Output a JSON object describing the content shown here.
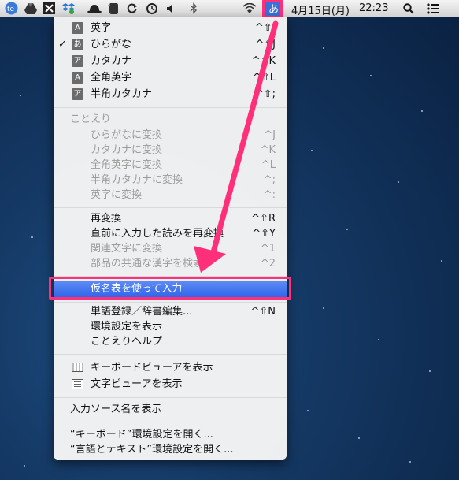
{
  "menubar": {
    "icons": [
      "te-icon",
      "drive-icon",
      "x-icon",
      "dropbox-icon",
      "hat-icon",
      "evernote-icon",
      "sync-icon",
      "time-machine-icon",
      "volume-icon",
      "bluetooth-icon",
      "wifi-icon"
    ],
    "ime_label": "あ",
    "date": "4月15日(月)",
    "time": "22:23"
  },
  "menu": {
    "modes": [
      {
        "glyph": "A",
        "label": "英字",
        "shortcut": "^⇧;"
      },
      {
        "glyph": "あ",
        "label": "ひらがな",
        "shortcut": "^⇧J",
        "checked": true
      },
      {
        "glyph": "ア",
        "label": "カタカナ",
        "shortcut": "^⇧K"
      },
      {
        "glyph": "A",
        "label": "全角英字",
        "shortcut": "^⇧L"
      },
      {
        "glyph": "ア",
        "label": "半角カタカナ",
        "shortcut": "^⇧;"
      }
    ],
    "kotoeri_header": "ことえり",
    "convert": [
      {
        "label": "ひらがなに変換",
        "shortcut": "^J"
      },
      {
        "label": "カタカナに変換",
        "shortcut": "^K"
      },
      {
        "label": "全角英字に変換",
        "shortcut": "^L"
      },
      {
        "label": "半角カタカナに変換",
        "shortcut": "^;"
      },
      {
        "label": "英字に変換",
        "shortcut": "^:"
      }
    ],
    "edit": [
      {
        "label": "再変換",
        "shortcut": "^⇧R",
        "enabled": true
      },
      {
        "label": "直前に入力した読みを再変換",
        "shortcut": "^⇧Y",
        "enabled": true
      },
      {
        "label": "関連文字に変換",
        "shortcut": "^1",
        "enabled": false
      },
      {
        "label": "部品の共通な漢字を検索",
        "shortcut": "^2",
        "enabled": false
      }
    ],
    "kana_input": "仮名表を使って入力",
    "tools": [
      {
        "label": "単語登録／辞書編集...",
        "shortcut": "^⇧N"
      },
      {
        "label": "環境設定を表示",
        "shortcut": ""
      },
      {
        "label": "ことえりヘルプ",
        "shortcut": ""
      }
    ],
    "viewers": [
      {
        "label": "キーボードビューアを表示"
      },
      {
        "label": "文字ビューアを表示"
      }
    ],
    "show_source": "入力ソース名を表示",
    "prefs": [
      {
        "label": "“キーボード”環境設定を開く..."
      },
      {
        "label": "“言語とテキスト”環境設定を開く..."
      }
    ]
  },
  "colors": {
    "highlight": "#2d63e9",
    "annotation": "#ff2f7a"
  }
}
